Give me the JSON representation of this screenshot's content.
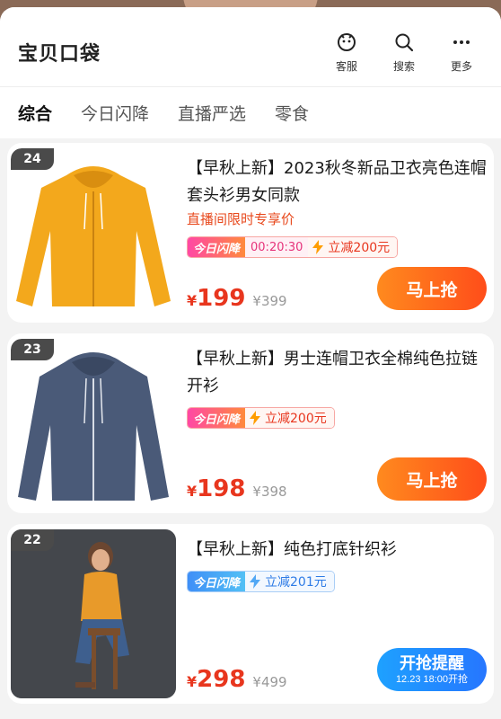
{
  "header": {
    "title": "宝贝口袋",
    "actions": [
      {
        "label": "客服",
        "icon": "customer-service-icon"
      },
      {
        "label": "搜索",
        "icon": "search-icon"
      },
      {
        "label": "更多",
        "icon": "more-icon"
      }
    ]
  },
  "tabs": [
    {
      "label": "综合",
      "active": true
    },
    {
      "label": "今日闪降",
      "active": false
    },
    {
      "label": "直播严选",
      "active": false
    },
    {
      "label": "零食",
      "active": false
    }
  ],
  "products": [
    {
      "rank": "24",
      "title": "【早秋上新】2023秋冬新品卫衣亮色连帽套头衫男女同款",
      "promo": "直播间限时专享价",
      "tag_label": "今日闪降",
      "tag_time": "00:20:30",
      "tag_discount": "立减200元",
      "currency": "¥",
      "price": "199",
      "original_price": "¥399",
      "button": "马上抢"
    },
    {
      "rank": "23",
      "title": "【早秋上新】男士连帽卫衣全棉纯色拉链开衫",
      "tag_label": "今日闪降",
      "tag_discount": "立减200元",
      "currency": "¥",
      "price": "198",
      "original_price": "¥398",
      "button": "马上抢"
    },
    {
      "rank": "22",
      "title": "【早秋上新】纯色打底针织衫",
      "tag_label": "今日闪降",
      "tag_discount": "立减201元",
      "currency": "¥",
      "price": "298",
      "original_price": "¥499",
      "button": "开抢提醒",
      "button_sub": "12.23 18:00开抢"
    }
  ],
  "colors": {
    "price_red": "#e8361e",
    "buy_button": "#ff6a1e",
    "remind_button": "#2384ff",
    "rank_badge": "#4a4a4a"
  }
}
